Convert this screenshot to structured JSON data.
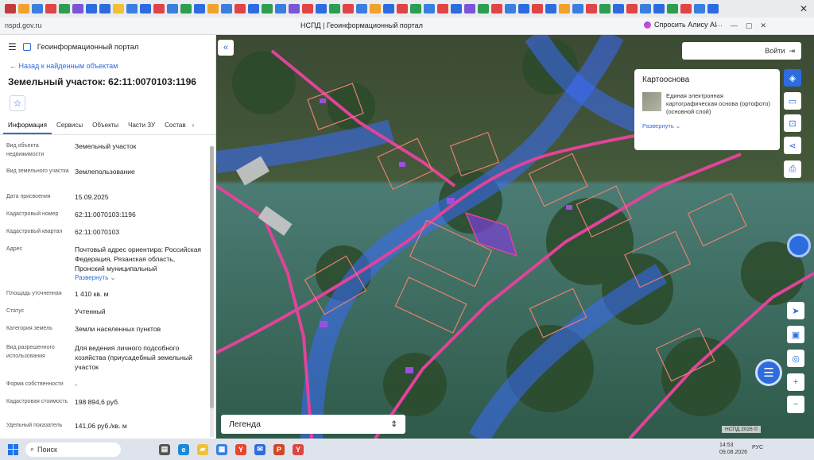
{
  "browser": {
    "url": "nspd.gov.ru",
    "page_title": "НСПД | Геоинформационный портал",
    "alisa": "Спросить Алису AI"
  },
  "panel": {
    "portal_name": "Геоинформационный портал",
    "back_link": "Назад к найденным объектам",
    "object_title": "Земельный участок: 62:11:0070103:1196",
    "tabs": [
      "Информация",
      "Сервисы",
      "Объекты",
      "Части ЗУ",
      "Состав"
    ],
    "fields": [
      {
        "label": "Вид объекта недвижимости",
        "value": "Земельный участок"
      },
      {
        "label": "Вид земельного участка",
        "value": "Землепользование"
      },
      {
        "label": "Дата присвоения",
        "value": "15.09.2025"
      },
      {
        "label": "Кадастровый номер",
        "value": "62:11:0070103:1196"
      },
      {
        "label": "Кадастровый квартал",
        "value": "62:11:0070103"
      },
      {
        "label": "Адрес",
        "value": "Почтовый адрес ориентира: Российская Федерация, Рязанская область, Пронский муниципальный",
        "link": "Развернуть"
      },
      {
        "label": "Площадь уточненная",
        "value": "1 410 кв. м"
      },
      {
        "label": "Статус",
        "value": "Учтенный"
      },
      {
        "label": "Категория земель",
        "value": "Земли населенных пунктов"
      },
      {
        "label": "Вид разрешенного использования",
        "value": "Для ведения личного подсобного хозяйства (приусадебный земельный участок"
      },
      {
        "label": "Форма собственности",
        "value": "-"
      },
      {
        "label": "Кадастровая стоимость",
        "value": "198 894,6 руб."
      },
      {
        "label": "Удельный показатель",
        "value": "141,06 руб./кв. м"
      }
    ]
  },
  "map": {
    "login": "Войти",
    "kartosnova_title": "Картооснова",
    "layer_name": "Единая электронная картографическая основа (ортофото)(основной слой)",
    "expand_link": "Развернуть",
    "legend": "Легенда",
    "attribution": "НСПД 2026 ©"
  },
  "taskbar": {
    "search": "Поиск",
    "lang": "РУС",
    "time": "14:53",
    "date": "09.08.2026"
  },
  "colors": {
    "accent": "#2d6cdf",
    "parcel_pink": "#e0449a",
    "zone_blue": "#3a6bff",
    "selected_purple": "#7b3fd4"
  }
}
